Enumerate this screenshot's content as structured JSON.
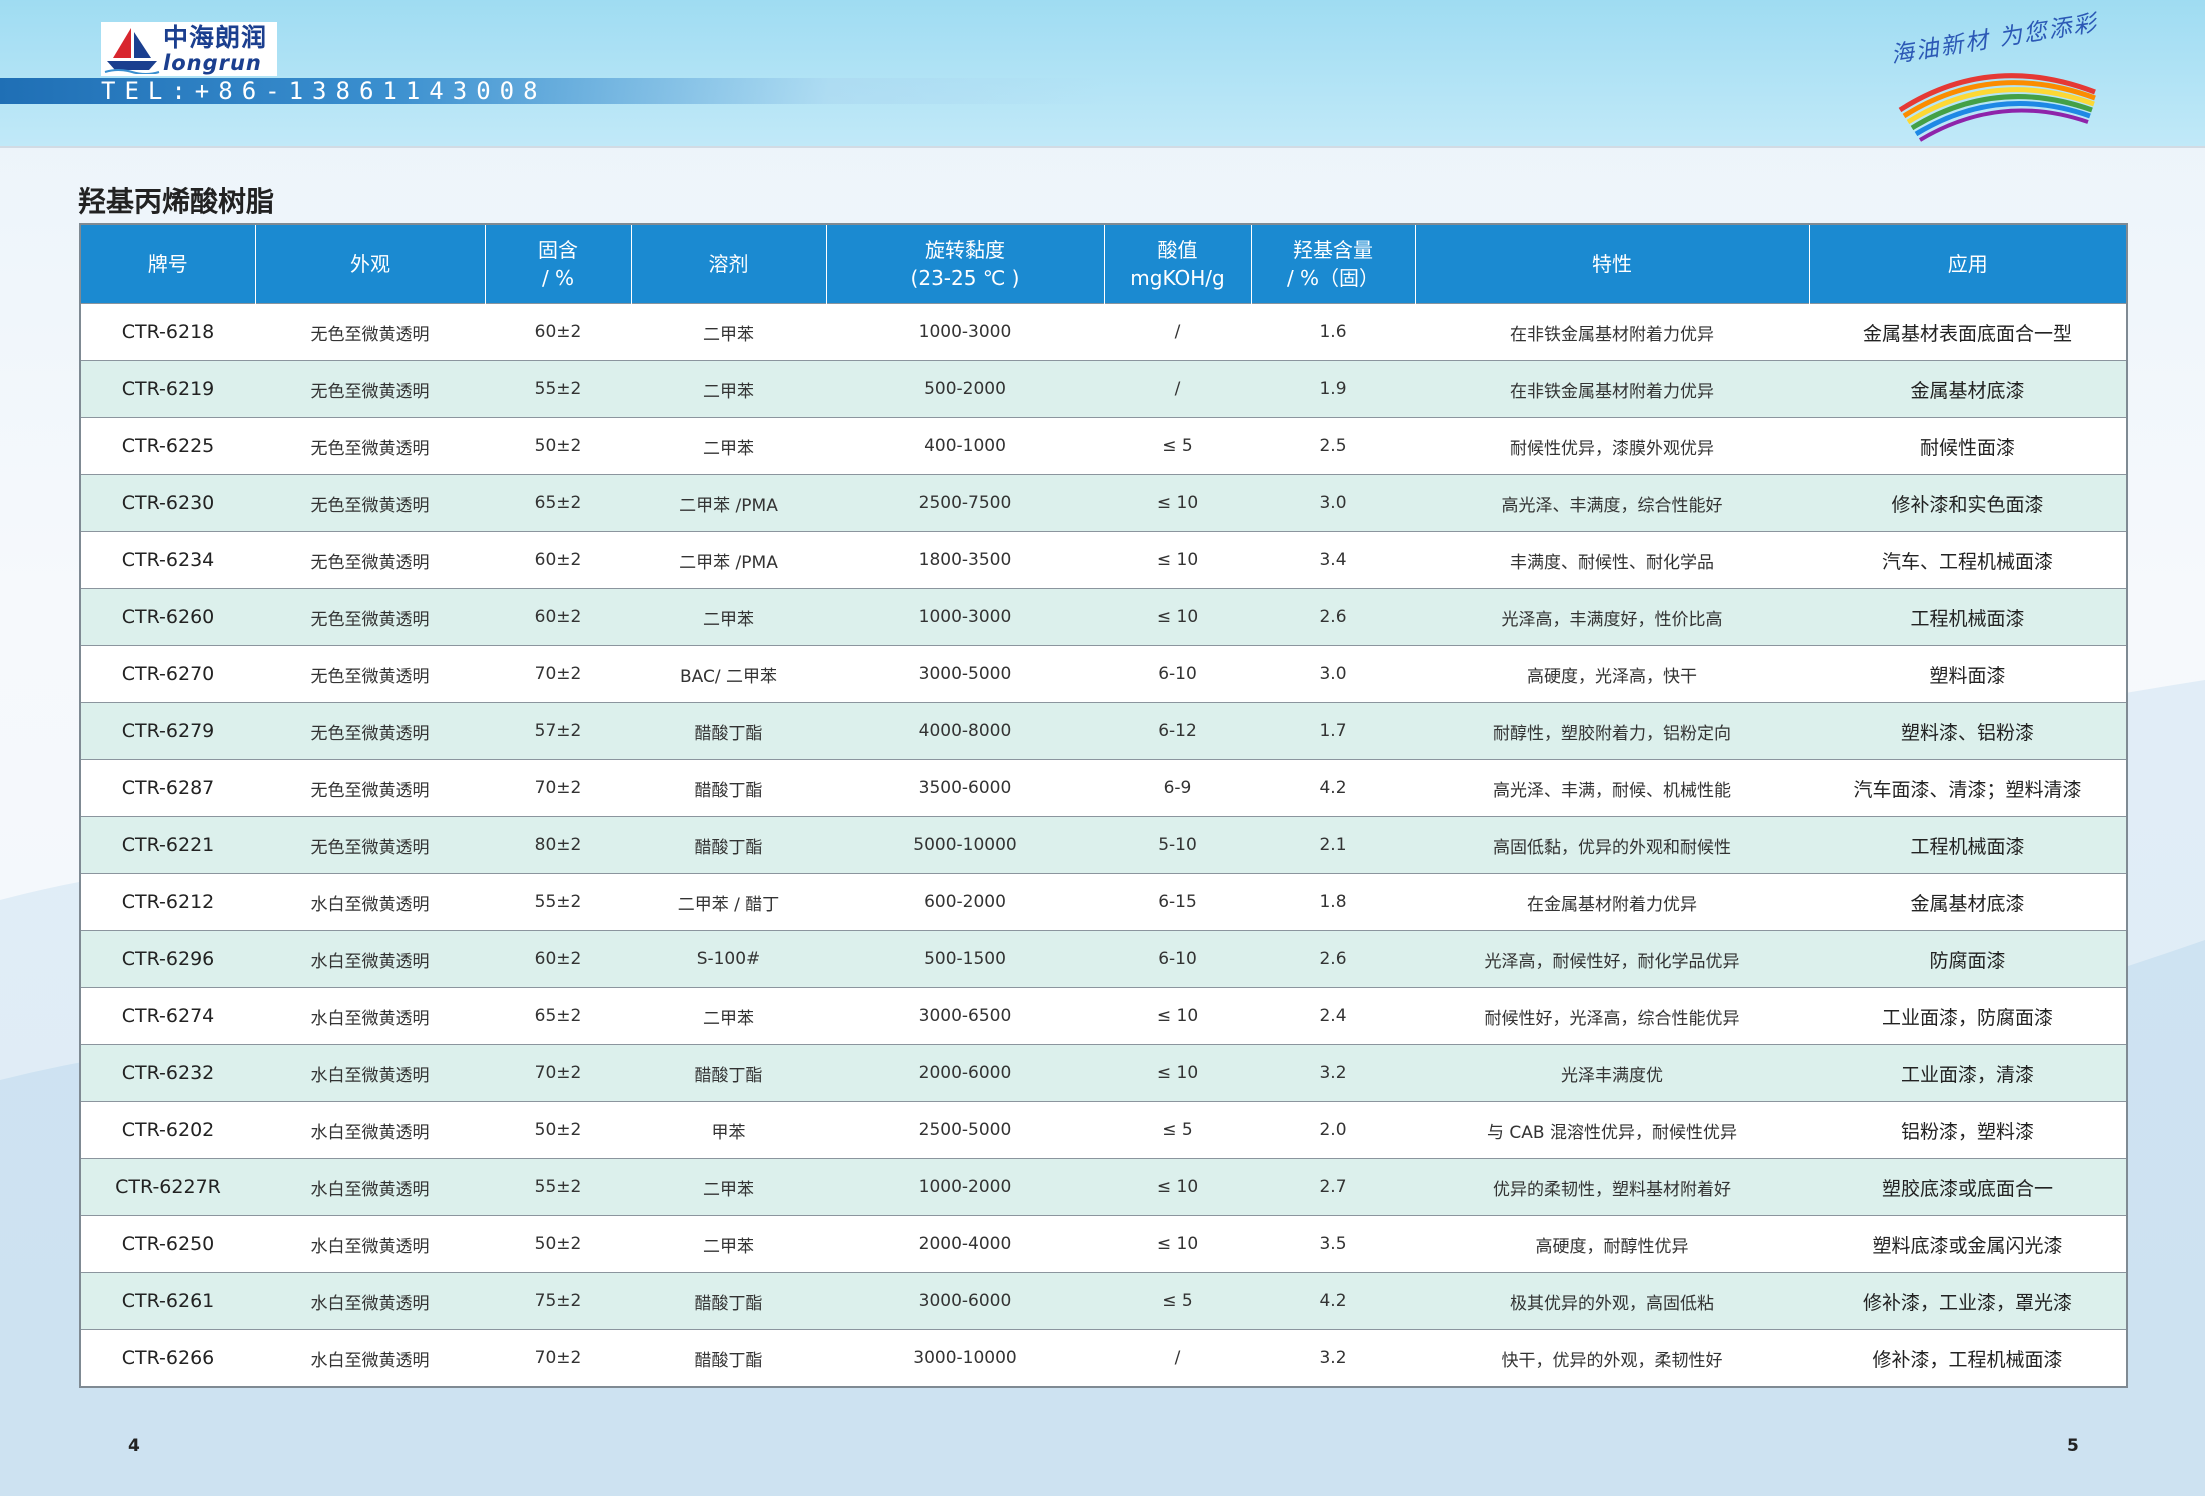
{
  "header": {
    "logo_cn": "中海朗润",
    "logo_en": "longrun",
    "tel": "TEL:+86-13861143008",
    "slogan": "海油新材 为您添彩"
  },
  "section_title": "羟基丙烯酸树脂",
  "table": {
    "columns": [
      {
        "line1": "牌号",
        "line2": ""
      },
      {
        "line1": "外观",
        "line2": ""
      },
      {
        "line1": "固含",
        "line2": "/ %"
      },
      {
        "line1": "溶剂",
        "line2": ""
      },
      {
        "line1": "旋转黏度",
        "line2": "(23-25 ℃ )"
      },
      {
        "line1": "酸值",
        "line2": "mgKOH/g"
      },
      {
        "line1": "羟基含量",
        "line2": "/ %（固）"
      },
      {
        "line1": "特性",
        "line2": ""
      },
      {
        "line1": "应用",
        "line2": ""
      }
    ],
    "rows": [
      [
        "CTR-6218",
        "无色至微黄透明",
        "60±2",
        "二甲苯",
        "1000-3000",
        "/",
        "1.6",
        "在非铁金属基材附着力优异",
        "金属基材表面底面合一型"
      ],
      [
        "CTR-6219",
        "无色至微黄透明",
        "55±2",
        "二甲苯",
        "500-2000",
        "/",
        "1.9",
        "在非铁金属基材附着力优异",
        "金属基材底漆"
      ],
      [
        "CTR-6225",
        "无色至微黄透明",
        "50±2",
        "二甲苯",
        "400-1000",
        "≤ 5",
        "2.5",
        "耐候性优异，漆膜外观优异",
        "耐候性面漆"
      ],
      [
        "CTR-6230",
        "无色至微黄透明",
        "65±2",
        "二甲苯 /PMA",
        "2500-7500",
        "≤ 10",
        "3.0",
        "高光泽、丰满度，综合性能好",
        "修补漆和实色面漆"
      ],
      [
        "CTR-6234",
        "无色至微黄透明",
        "60±2",
        "二甲苯 /PMA",
        "1800-3500",
        "≤ 10",
        "3.4",
        "丰满度、耐候性、耐化学品",
        "汽车、工程机械面漆"
      ],
      [
        "CTR-6260",
        "无色至微黄透明",
        "60±2",
        "二甲苯",
        "1000-3000",
        "≤ 10",
        "2.6",
        "光泽高，丰满度好，性价比高",
        "工程机械面漆"
      ],
      [
        "CTR-6270",
        "无色至微黄透明",
        "70±2",
        "BAC/ 二甲苯",
        "3000-5000",
        "6-10",
        "3.0",
        "高硬度，光泽高，快干",
        "塑料面漆"
      ],
      [
        "CTR-6279",
        "无色至微黄透明",
        "57±2",
        "醋酸丁酯",
        "4000-8000",
        "6-12",
        "1.7",
        "耐醇性，塑胶附着力，铝粉定向",
        "塑料漆、铝粉漆"
      ],
      [
        "CTR-6287",
        "无色至微黄透明",
        "70±2",
        "醋酸丁酯",
        "3500-6000",
        "6-9",
        "4.2",
        "高光泽、丰满，耐候、机械性能",
        "汽车面漆、清漆；塑料清漆"
      ],
      [
        "CTR-6221",
        "无色至微黄透明",
        "80±2",
        "醋酸丁酯",
        "5000-10000",
        "5-10",
        "2.1",
        "高固低黏，优异的外观和耐候性",
        "工程机械面漆"
      ],
      [
        "CTR-6212",
        "水白至微黄透明",
        "55±2",
        "二甲苯 / 醋丁",
        "600-2000",
        "6-15",
        "1.8",
        "在金属基材附着力优异",
        "金属基材底漆"
      ],
      [
        "CTR-6296",
        "水白至微黄透明",
        "60±2",
        "S-100#",
        "500-1500",
        "6-10",
        "2.6",
        "光泽高，耐候性好，耐化学品优异",
        "防腐面漆"
      ],
      [
        "CTR-6274",
        "水白至微黄透明",
        "65±2",
        "二甲苯",
        "3000-6500",
        "≤ 10",
        "2.4",
        "耐候性好，光泽高，综合性能优异",
        "工业面漆，防腐面漆"
      ],
      [
        "CTR-6232",
        "水白至微黄透明",
        "70±2",
        "醋酸丁酯",
        "2000-6000",
        "≤ 10",
        "3.2",
        "光泽丰满度优",
        "工业面漆，清漆"
      ],
      [
        "CTR-6202",
        "水白至微黄透明",
        "50±2",
        "甲苯",
        "2500-5000",
        "≤ 5",
        "2.0",
        "与 CAB 混溶性优异，耐候性优异",
        "铝粉漆，塑料漆"
      ],
      [
        "CTR-6227R",
        "水白至微黄透明",
        "55±2",
        "二甲苯",
        "1000-2000",
        "≤ 10",
        "2.7",
        "优异的柔韧性，塑料基材附着好",
        "塑胶底漆或底面合一"
      ],
      [
        "CTR-6250",
        "水白至微黄透明",
        "50±2",
        "二甲苯",
        "2000-4000",
        "≤ 10",
        "3.5",
        "高硬度，耐醇性优异",
        "塑料底漆或金属闪光漆"
      ],
      [
        "CTR-6261",
        "水白至微黄透明",
        "75±2",
        "醋酸丁酯",
        "3000-6000",
        "≤ 5",
        "4.2",
        "极其优异的外观，高固低粘",
        "修补漆，工业漆，罩光漆"
      ],
      [
        "CTR-6266",
        "水白至微黄透明",
        "70±2",
        "醋酸丁酯",
        "3000-10000",
        "/",
        "3.2",
        "快干，优异的外观，柔韧性好",
        "修补漆，工程机械面漆"
      ]
    ]
  },
  "page_numbers": {
    "left": "4",
    "right": "5"
  },
  "colors": {
    "header_blue": "#1b8ad1",
    "alt_row": "#dcf0ec",
    "brand_blue": "#1b3f8f"
  }
}
